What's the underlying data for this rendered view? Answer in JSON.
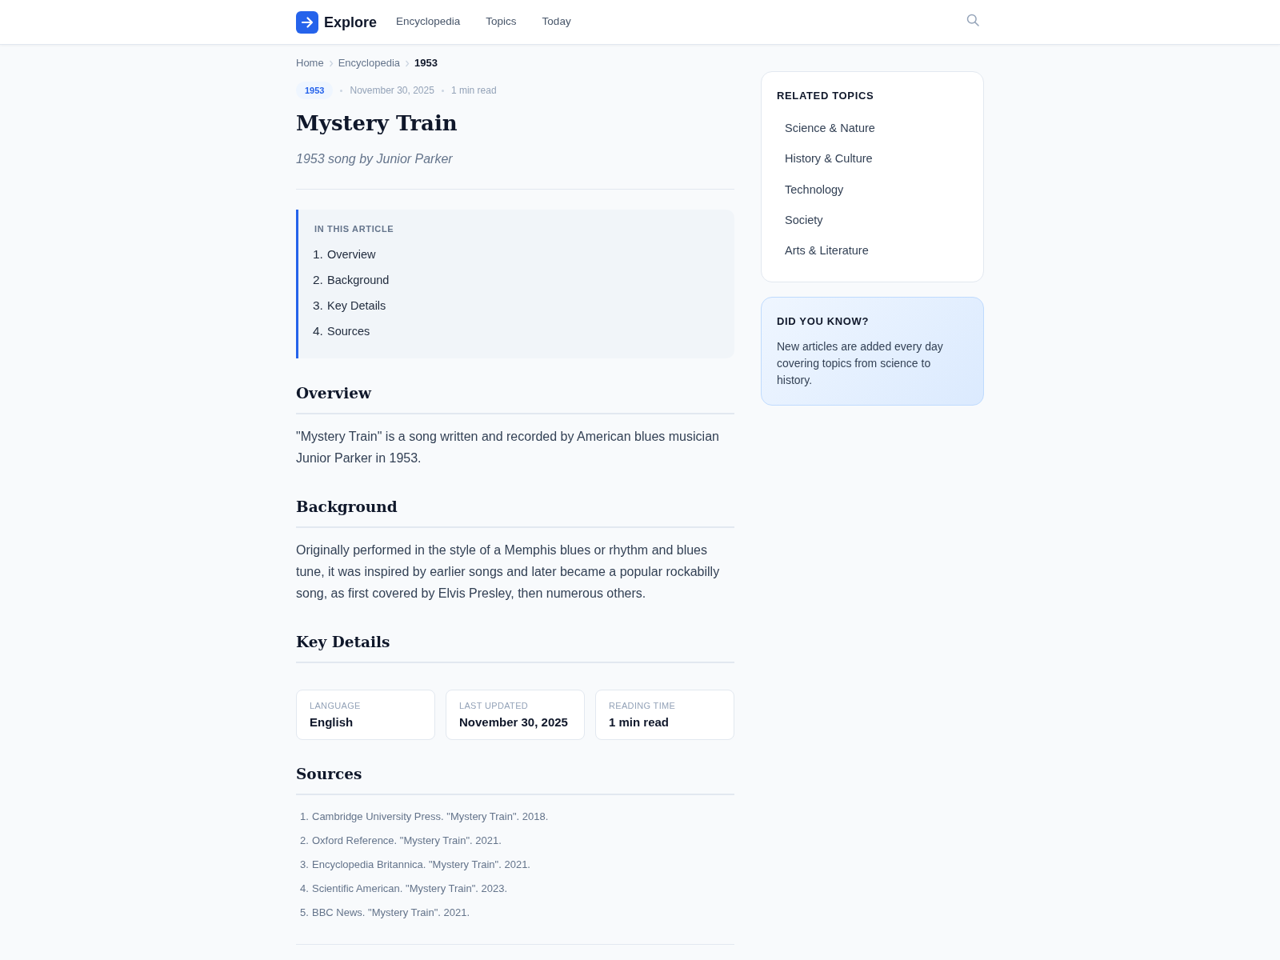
{
  "header": {
    "brand": "Explore",
    "nav": [
      {
        "label": "Encyclopedia"
      },
      {
        "label": "Topics"
      },
      {
        "label": "Today"
      }
    ]
  },
  "breadcrumb": [
    {
      "label": "Home",
      "current": false
    },
    {
      "label": "Encyclopedia",
      "current": false
    },
    {
      "label": "1953",
      "current": true
    }
  ],
  "article": {
    "tag": "1953",
    "date": "November 30, 2025",
    "read_time": "1 min read",
    "title": "Mystery Train",
    "subtitle": "1953 song by Junior Parker",
    "toc": {
      "title": "IN THIS ARTICLE",
      "items": [
        {
          "number": "1.",
          "label": "Overview"
        },
        {
          "number": "2.",
          "label": "Background"
        },
        {
          "number": "3.",
          "label": "Key Details"
        },
        {
          "number": "4.",
          "label": "Sources"
        }
      ]
    },
    "sections": [
      {
        "kind": "text",
        "heading": "Overview",
        "paragraphs": [
          "\"Mystery Train\" is a song written and recorded by American blues musician Junior Parker in 1953."
        ]
      },
      {
        "kind": "text",
        "heading": "Background",
        "paragraphs": [
          "Originally performed in the style of a Memphis blues or rhythm and blues tune, it was inspired by earlier songs and later became a popular rockabilly song, as first covered by Elvis Presley, then numerous others."
        ]
      },
      {
        "kind": "details",
        "heading": "Key Details",
        "details": [
          {
            "label": "LANGUAGE",
            "value": "English"
          },
          {
            "label": "LAST UPDATED",
            "value": "November 30, 2025"
          },
          {
            "label": "READING TIME",
            "value": "1 min read"
          }
        ]
      },
      {
        "kind": "sources",
        "heading": "Sources",
        "sources": [
          {
            "number": "1.",
            "text": "Cambridge University Press. \"Mystery Train\". 2018."
          },
          {
            "number": "2.",
            "text": "Oxford Reference. \"Mystery Train\". 2021."
          },
          {
            "number": "3.",
            "text": "Encyclopedia Britannica. \"Mystery Train\". 2021."
          },
          {
            "number": "4.",
            "text": "Scientific American. \"Mystery Train\". 2023."
          },
          {
            "number": "5.",
            "text": "BBC News. \"Mystery Train\". 2021."
          }
        ]
      }
    ]
  },
  "sidebar": {
    "related_topics": {
      "title": "RELATED TOPICS",
      "items": [
        "Science & Nature",
        "History & Culture",
        "Technology",
        "Society",
        "Arts & Literature"
      ]
    },
    "did_you_know": {
      "title": "DID YOU KNOW?",
      "text": "New articles are added every day covering topics from science to history."
    }
  }
}
